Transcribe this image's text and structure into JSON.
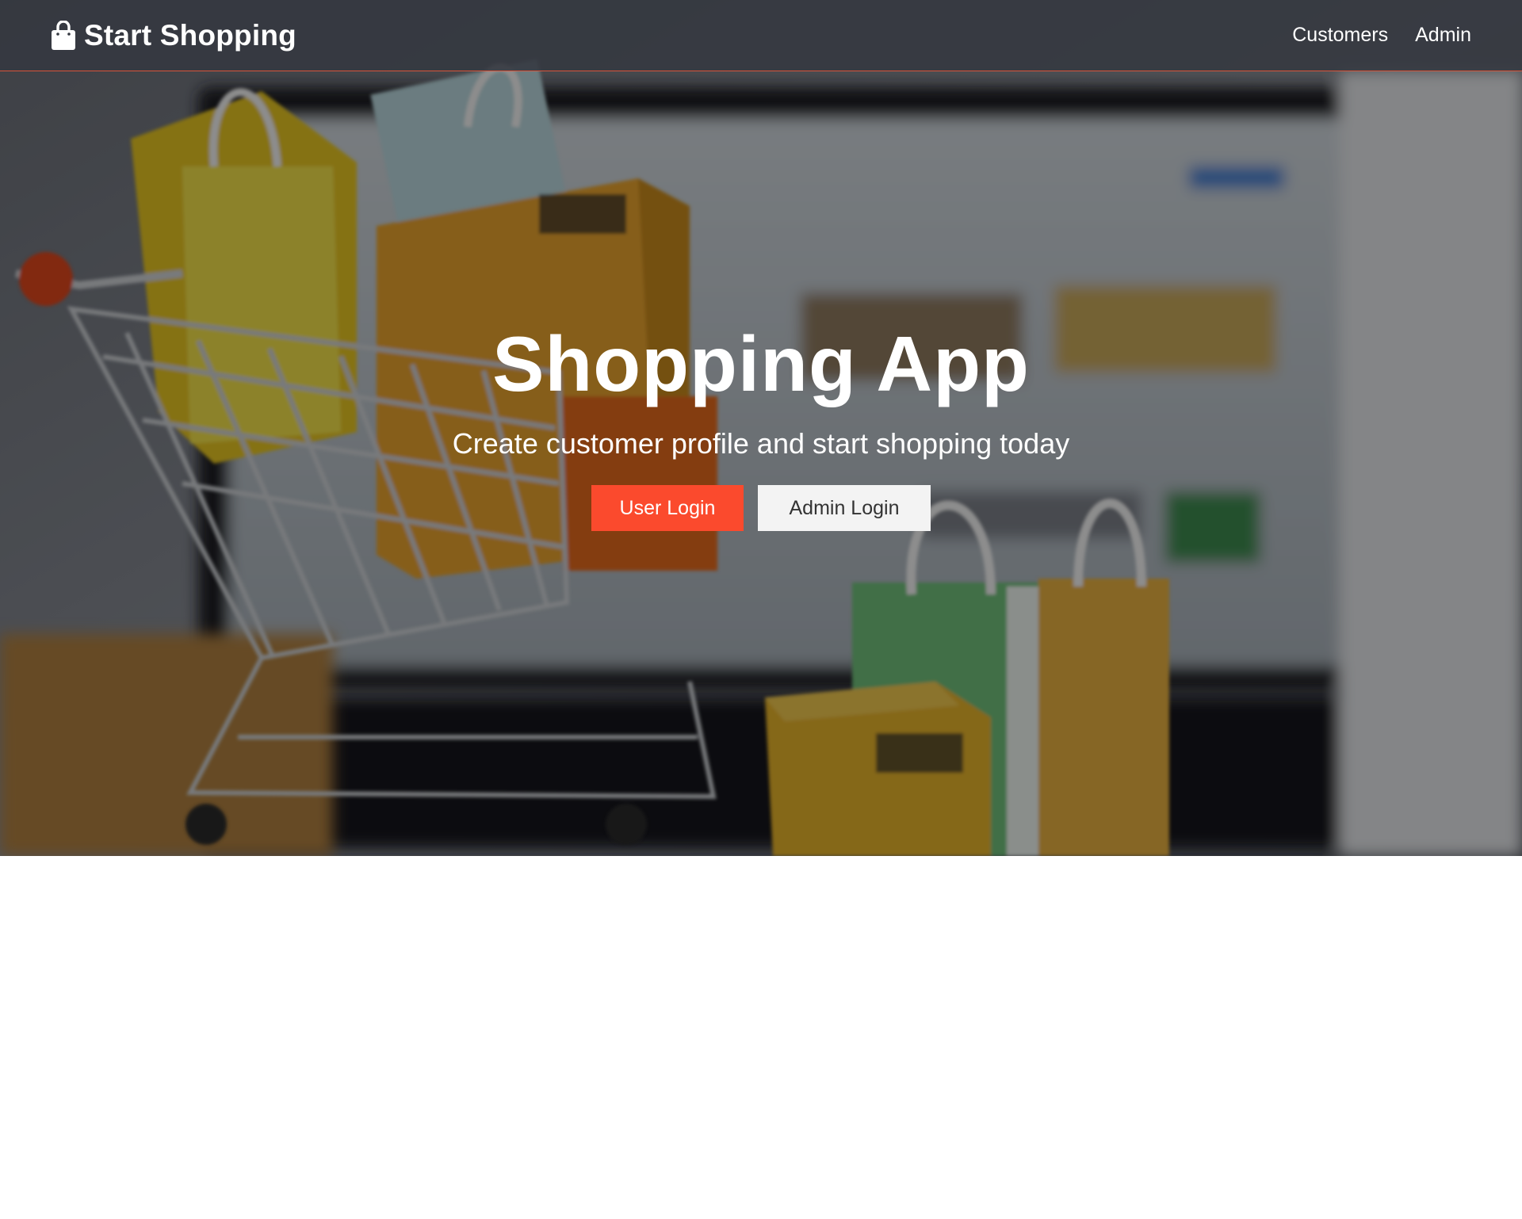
{
  "navbar": {
    "brand_icon": "shopping-bag-icon",
    "brand_label": "Start Shopping",
    "links": [
      {
        "label": "Customers"
      },
      {
        "label": "Admin"
      }
    ],
    "accent_border_color": "#d9543a"
  },
  "hero": {
    "title": "Shopping App",
    "subtitle": "Create customer profile and start shopping today",
    "background": "shopping-cart-with-boxes-and-bags-photo",
    "buttons": {
      "user_login": "User Login",
      "admin_login": "Admin Login"
    }
  },
  "colors": {
    "primary_button": "#fb4a2d",
    "secondary_button": "#f3f3f3",
    "navbar_bg": "#343840"
  }
}
